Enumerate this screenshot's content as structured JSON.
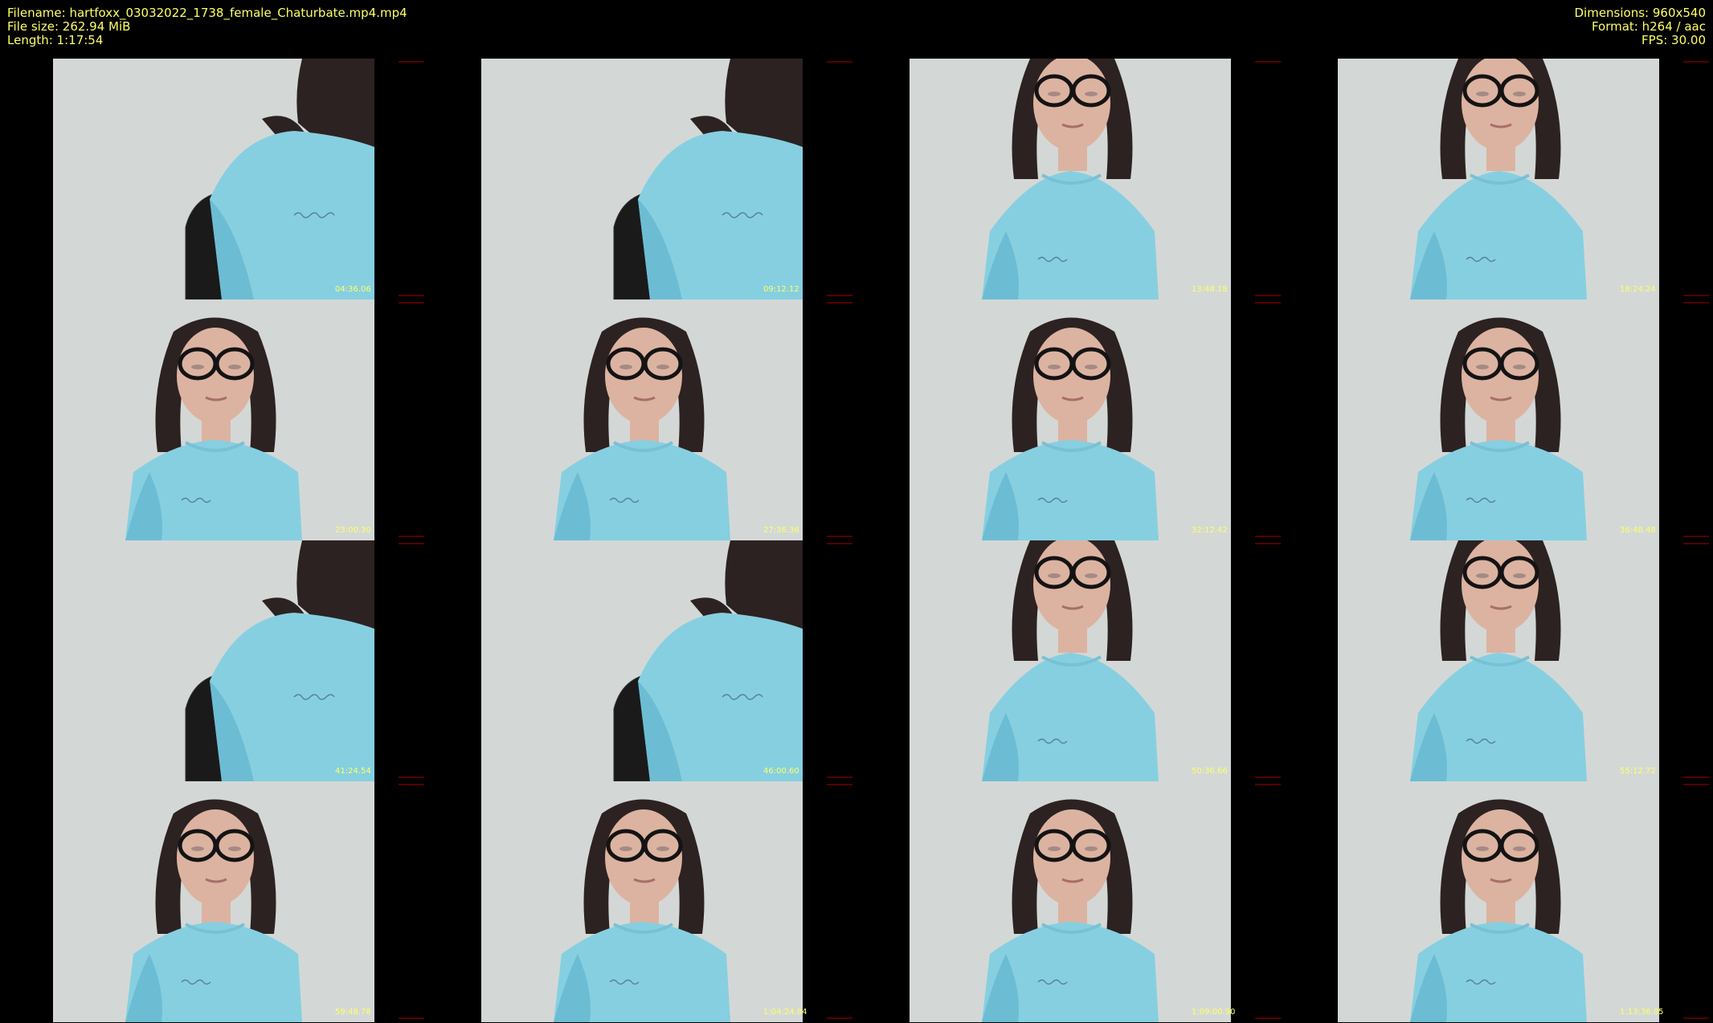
{
  "header": {
    "left": {
      "filename": "Filename: hartfoxx_03032022_1738_female_Chaturbate.mp4.mp4",
      "filesize": "File size: 262.94 MiB",
      "length": "Length: 1:17:54"
    },
    "right": {
      "dimensions": "Dimensions: 960x540",
      "format": "Format: h264 / aac",
      "fps": "FPS: 30.00"
    }
  },
  "thumbnails": [
    {
      "time": "04:36.06",
      "pose": "side"
    },
    {
      "time": "09:12.12",
      "pose": "side"
    },
    {
      "time": "13:48.18",
      "pose": "front-high"
    },
    {
      "time": "18:24.24",
      "pose": "front-high"
    },
    {
      "time": "23:00.30",
      "pose": "front"
    },
    {
      "time": "27:36.36",
      "pose": "front"
    },
    {
      "time": "32:12.42",
      "pose": "front"
    },
    {
      "time": "36:48.48",
      "pose": "front"
    },
    {
      "time": "41:24.54",
      "pose": "side"
    },
    {
      "time": "46:00.60",
      "pose": "side"
    },
    {
      "time": "50:36.66",
      "pose": "front-high"
    },
    {
      "time": "55:12.72",
      "pose": "front-high"
    },
    {
      "time": "59:48.78",
      "pose": "front"
    },
    {
      "time": "1:04:24.84",
      "pose": "front"
    },
    {
      "time": "1:09:00.90",
      "pose": "front"
    },
    {
      "time": "1:13:36.95",
      "pose": "front"
    }
  ]
}
